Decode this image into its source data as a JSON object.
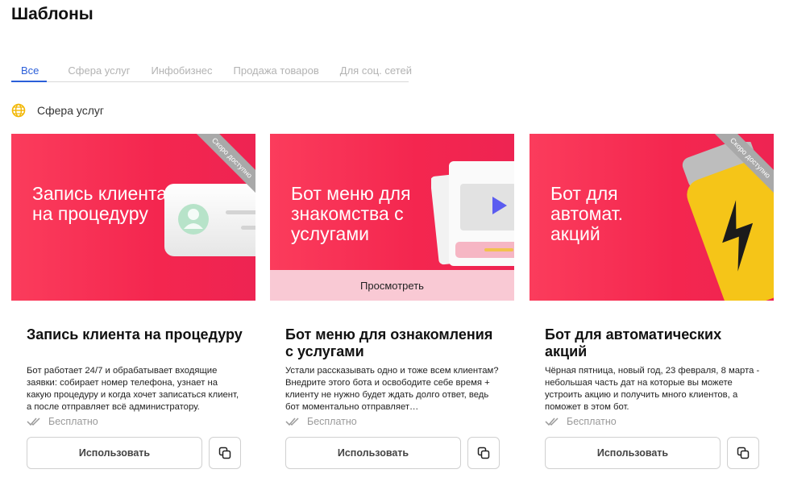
{
  "page": {
    "title": "Шаблоны"
  },
  "tabs": [
    {
      "label": "Все",
      "active": true
    },
    {
      "label": "Сфера услуг",
      "active": false
    },
    {
      "label": "Инфобизнес",
      "active": false
    },
    {
      "label": "Продажа товаров",
      "active": false
    },
    {
      "label": "Для соц. сетей",
      "active": false
    }
  ],
  "section": {
    "title": "Сфера услуг",
    "icon": "globe-icon",
    "icon_color": "#f2b705"
  },
  "colors": {
    "accent": "#2b5fd9",
    "card_red": "#f4264f",
    "ribbon": "#a9a9a9"
  },
  "cards": [
    {
      "image_heading": "Запись клиента на процедуру",
      "ribbon": "Скоро доступно",
      "title": "Запись клиента на процедуру",
      "description": "Бот работает 24/7 и обрабатывает входящие заявки: собирает номер телефона, узнает на какую процедуру и когда хочет записаться клиент, а после отправляет всё администратору.",
      "price": "Бесплатно",
      "use_label": "Использовать",
      "illustration": "contact-card-illustration"
    },
    {
      "image_heading": "Бот меню для знакомства с услугами",
      "ribbon": "",
      "preview_label": "Просмотреть",
      "title": "Бот меню для ознакомления с услугами",
      "description": "Устали рассказывать одно и тоже всем клиентам? Внедрите этого бота и освободите себе время + клиенту не нужно будет ждать долго ответ, ведь бот моментально отправляет…",
      "price": "Бесплатно",
      "use_label": "Использовать",
      "illustration": "video-player-illustration"
    },
    {
      "image_heading": "Бот для автомат. акций",
      "ribbon": "Скоро доступно",
      "title": "Бот для автоматических акций",
      "description": "Чёрная пятница, новый год, 23 февраля, 8 марта - небольшая часть дат на которые вы можете устроить акцию и получить много клиентов, а поможет в этом бот.",
      "price": "Бесплатно",
      "use_label": "Использовать",
      "illustration": "battery-lightning-illustration"
    }
  ]
}
